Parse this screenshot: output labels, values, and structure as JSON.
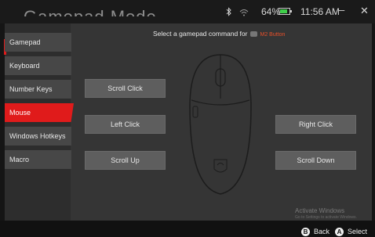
{
  "app": {
    "title": "Gamepad Mode"
  },
  "status_bar": {
    "bluetooth_icon": "bluetooth-icon",
    "wifi_icon": "wifi-icon",
    "battery_percent": "64%",
    "battery_level": 0.64,
    "time": "11:56 AM",
    "minimize": "–",
    "close": "✕"
  },
  "sidebar": {
    "items": [
      {
        "label": "Gamepad"
      },
      {
        "label": "Keyboard"
      },
      {
        "label": "Number Keys"
      },
      {
        "label": "Mouse",
        "selected": true
      },
      {
        "label": "Windows Hotkeys"
      },
      {
        "label": "Macro"
      }
    ]
  },
  "prompt": {
    "text": "Select a gamepad command for",
    "button_label": "M2 Button"
  },
  "commands": {
    "scroll_click": "Scroll Click",
    "left_click": "Left Click",
    "scroll_up": "Scroll Up",
    "right_click": "Right Click",
    "scroll_down": "Scroll Down"
  },
  "watermark": {
    "line1": "Activate Windows",
    "line2": "Go to Settings to activate Windows."
  },
  "footer": {
    "back_key": "B",
    "back_label": "Back",
    "select_key": "A",
    "select_label": "Select"
  },
  "colors": {
    "accent": "#e01b1b",
    "button_bg": "#5e5e5e",
    "panel_bg": "#353535"
  }
}
